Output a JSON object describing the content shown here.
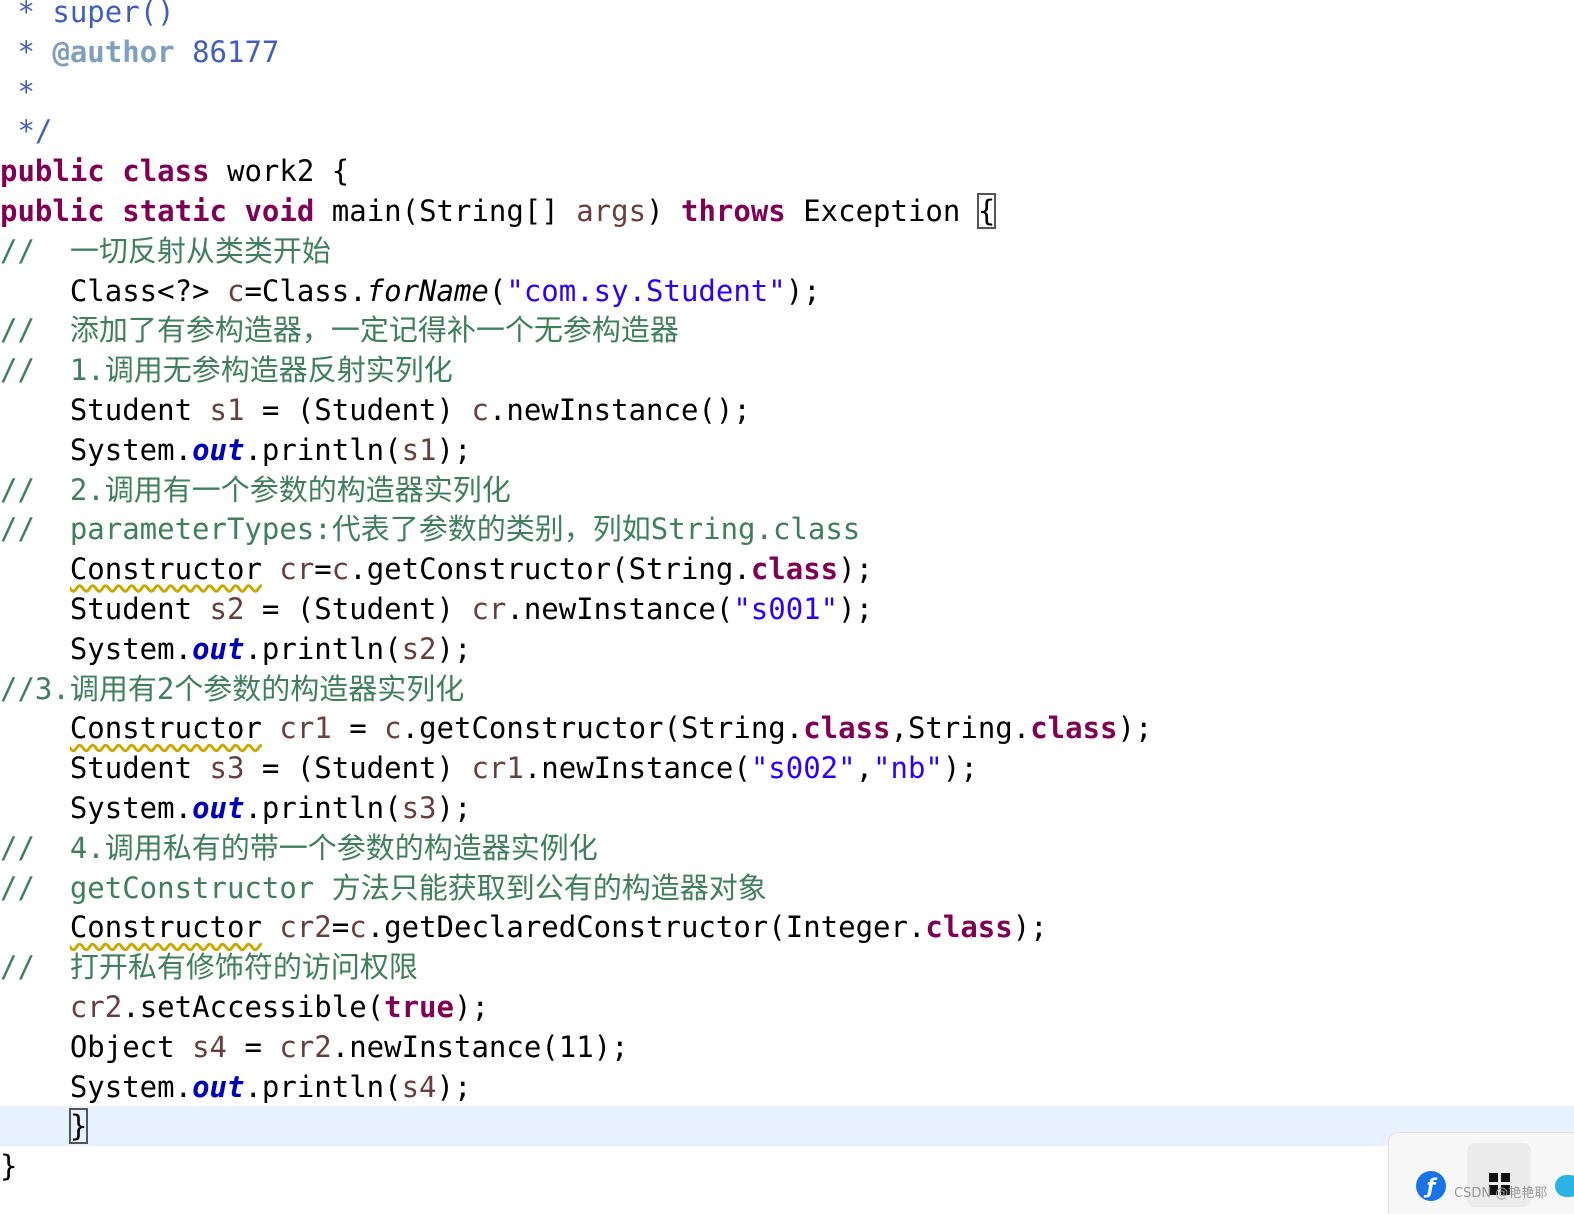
{
  "editor": {
    "lines": [
      {
        "id": "L01",
        "indent": " ",
        "tokens": [
          {
            "t": "* ",
            "k": "javadoc"
          },
          {
            "t": "super()",
            "k": "javadoc"
          }
        ]
      },
      {
        "id": "L02",
        "indent": " ",
        "tokens": [
          {
            "t": "* ",
            "k": "javadoc"
          },
          {
            "t": "@author",
            "k": "doctag"
          },
          {
            "t": " 86177",
            "k": "javadoc"
          }
        ]
      },
      {
        "id": "L03",
        "indent": " ",
        "tokens": [
          {
            "t": "*",
            "k": "javadoc"
          }
        ]
      },
      {
        "id": "L04",
        "indent": " ",
        "tokens": [
          {
            "t": "*/",
            "k": "javadoc"
          }
        ]
      },
      {
        "id": "L05",
        "indent": "",
        "tokens": [
          {
            "t": "public",
            "k": "keyword"
          },
          {
            "t": " "
          },
          {
            "t": "class",
            "k": "keyword"
          },
          {
            "t": " work2 {"
          }
        ]
      },
      {
        "id": "L06",
        "indent": "",
        "tokens": [
          {
            "t": "public",
            "k": "keyword"
          },
          {
            "t": " "
          },
          {
            "t": "static",
            "k": "keyword"
          },
          {
            "t": " "
          },
          {
            "t": "void",
            "k": "keyword"
          },
          {
            "t": " main(String[] "
          },
          {
            "t": "args",
            "k": "variable"
          },
          {
            "t": ") "
          },
          {
            "t": "throws",
            "k": "keyword"
          },
          {
            "t": " Exception "
          },
          {
            "t": "{",
            "k": "bracket-match"
          }
        ]
      },
      {
        "id": "L07",
        "indent": "",
        "tokens": [
          {
            "t": "//  一切反射从类类开始",
            "k": "comment"
          }
        ]
      },
      {
        "id": "L08",
        "indent": "    ",
        "tokens": [
          {
            "t": "Class<?> "
          },
          {
            "t": "c",
            "k": "variable"
          },
          {
            "t": "=Class."
          },
          {
            "t": "forName",
            "k": "static-method"
          },
          {
            "t": "("
          },
          {
            "t": "\"com.sy.Student\"",
            "k": "string"
          },
          {
            "t": ");"
          }
        ]
      },
      {
        "id": "L09",
        "indent": "",
        "tokens": [
          {
            "t": "//  添加了有参构造器，一定记得补一个无参构造器",
            "k": "comment"
          }
        ]
      },
      {
        "id": "L10",
        "indent": "",
        "tokens": [
          {
            "t": "//  1.调用无参构造器反射实列化",
            "k": "comment"
          }
        ]
      },
      {
        "id": "L11",
        "indent": "    ",
        "tokens": [
          {
            "t": "Student "
          },
          {
            "t": "s1",
            "k": "variable"
          },
          {
            "t": " = (Student) "
          },
          {
            "t": "c",
            "k": "variable"
          },
          {
            "t": ".newInstance();"
          }
        ]
      },
      {
        "id": "L12",
        "indent": "    ",
        "tokens": [
          {
            "t": "System."
          },
          {
            "t": "out",
            "k": "field"
          },
          {
            "t": ".println("
          },
          {
            "t": "s1",
            "k": "variable"
          },
          {
            "t": ");"
          }
        ]
      },
      {
        "id": "L13",
        "indent": "",
        "tokens": [
          {
            "t": "//  2.调用有一个参数的构造器实列化",
            "k": "comment"
          }
        ]
      },
      {
        "id": "L14",
        "indent": "",
        "tokens": [
          {
            "t": "//  parameterTypes:代表了参数的类别，列如String.class",
            "k": "comment"
          }
        ]
      },
      {
        "id": "L15",
        "indent": "    ",
        "tokens": [
          {
            "t": "Constructor",
            "k": "raw-warning"
          },
          {
            "t": " "
          },
          {
            "t": "cr",
            "k": "variable"
          },
          {
            "t": "="
          },
          {
            "t": "c",
            "k": "variable"
          },
          {
            "t": ".getConstructor(String."
          },
          {
            "t": "class",
            "k": "keyword"
          },
          {
            "t": ");"
          }
        ]
      },
      {
        "id": "L16",
        "indent": "    ",
        "tokens": [
          {
            "t": "Student "
          },
          {
            "t": "s2",
            "k": "variable"
          },
          {
            "t": " = (Student) "
          },
          {
            "t": "cr",
            "k": "variable"
          },
          {
            "t": ".newInstance("
          },
          {
            "t": "\"s001\"",
            "k": "string"
          },
          {
            "t": ");"
          }
        ]
      },
      {
        "id": "L17",
        "indent": "    ",
        "tokens": [
          {
            "t": "System."
          },
          {
            "t": "out",
            "k": "field"
          },
          {
            "t": ".println("
          },
          {
            "t": "s2",
            "k": "variable"
          },
          {
            "t": ");"
          }
        ]
      },
      {
        "id": "L18",
        "indent": "",
        "tokens": [
          {
            "t": "//3.调用有2个参数的构造器实列化",
            "k": "comment"
          }
        ]
      },
      {
        "id": "L19",
        "indent": "    ",
        "tokens": [
          {
            "t": "Constructor",
            "k": "raw-warning"
          },
          {
            "t": " "
          },
          {
            "t": "cr1",
            "k": "variable"
          },
          {
            "t": " = "
          },
          {
            "t": "c",
            "k": "variable"
          },
          {
            "t": ".getConstructor(String."
          },
          {
            "t": "class",
            "k": "keyword"
          },
          {
            "t": ",String."
          },
          {
            "t": "class",
            "k": "keyword"
          },
          {
            "t": ");"
          }
        ]
      },
      {
        "id": "L20",
        "indent": "    ",
        "tokens": [
          {
            "t": "Student "
          },
          {
            "t": "s3",
            "k": "variable"
          },
          {
            "t": " = (Student) "
          },
          {
            "t": "cr1",
            "k": "variable"
          },
          {
            "t": ".newInstance("
          },
          {
            "t": "\"s002\"",
            "k": "string"
          },
          {
            "t": ","
          },
          {
            "t": "\"nb\"",
            "k": "string"
          },
          {
            "t": ");"
          }
        ]
      },
      {
        "id": "L21",
        "indent": "    ",
        "tokens": [
          {
            "t": "System."
          },
          {
            "t": "out",
            "k": "field"
          },
          {
            "t": ".println("
          },
          {
            "t": "s3",
            "k": "variable"
          },
          {
            "t": ");"
          }
        ]
      },
      {
        "id": "L22",
        "indent": "",
        "tokens": [
          {
            "t": "//  4.调用私有的带一个参数的构造器实例化",
            "k": "comment"
          }
        ]
      },
      {
        "id": "L23",
        "indent": "",
        "tokens": [
          {
            "t": "//  getConstructor 方法只能获取到公有的构造器对象",
            "k": "comment"
          }
        ]
      },
      {
        "id": "L24",
        "indent": "    ",
        "tokens": [
          {
            "t": "Constructor",
            "k": "raw-warning"
          },
          {
            "t": " "
          },
          {
            "t": "cr2",
            "k": "variable"
          },
          {
            "t": "="
          },
          {
            "t": "c",
            "k": "variable"
          },
          {
            "t": ".getDeclaredConstructor(Integer."
          },
          {
            "t": "class",
            "k": "keyword"
          },
          {
            "t": ");"
          }
        ]
      },
      {
        "id": "L25",
        "indent": "",
        "tokens": [
          {
            "t": "//  打开私有修饰符的访问权限",
            "k": "comment"
          }
        ]
      },
      {
        "id": "L26",
        "indent": "    ",
        "tokens": [
          {
            "t": "cr2",
            "k": "variable"
          },
          {
            "t": ".setAccessible("
          },
          {
            "t": "true",
            "k": "keyword"
          },
          {
            "t": ");"
          }
        ]
      },
      {
        "id": "L27",
        "indent": "    ",
        "tokens": [
          {
            "t": "Object "
          },
          {
            "t": "s4",
            "k": "variable"
          },
          {
            "t": " = "
          },
          {
            "t": "cr2",
            "k": "variable"
          },
          {
            "t": ".newInstance(11);"
          }
        ]
      },
      {
        "id": "L28",
        "indent": "    ",
        "tokens": [
          {
            "t": "System."
          },
          {
            "t": "out",
            "k": "field"
          },
          {
            "t": ".println("
          },
          {
            "t": "s4",
            "k": "variable"
          },
          {
            "t": ");"
          }
        ]
      },
      {
        "id": "L29",
        "indent": "    ",
        "current": true,
        "tokens": [
          {
            "t": "}",
            "k": "bracket-match"
          }
        ]
      },
      {
        "id": "L30",
        "indent": "",
        "tokens": [
          {
            "t": "}"
          }
        ]
      }
    ]
  },
  "theme": {
    "comment": "#3f7f5f",
    "javadoc": "#3f5fbf",
    "keyword": "#7f0055",
    "string": "#2a00ff",
    "field": "#0000c0",
    "variable": "#6a3e3e",
    "current_line": "#e8f2fe",
    "warning_underline": "#c9a800"
  },
  "tray": {
    "icons": [
      "browser-swirl-icon",
      "grid-logo-icon",
      "cloud-icon"
    ]
  },
  "watermark": "CSDN @艳艳耶"
}
